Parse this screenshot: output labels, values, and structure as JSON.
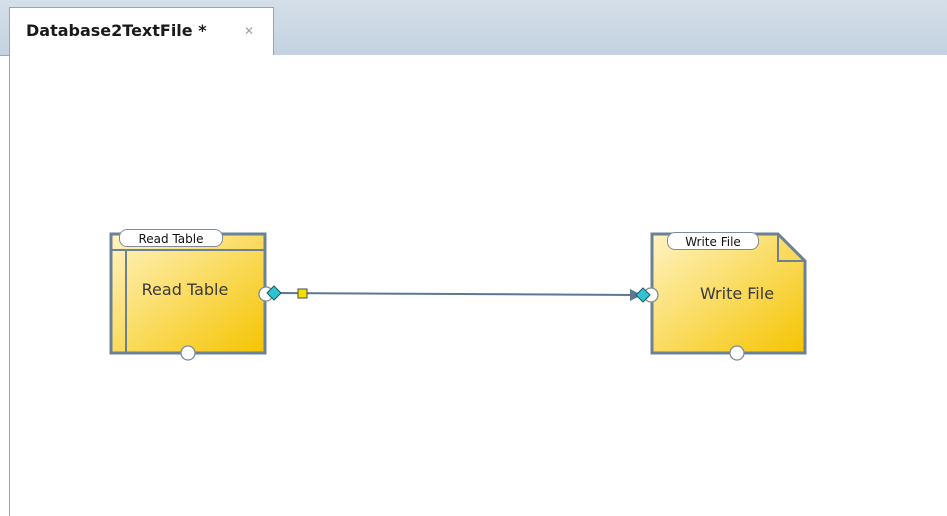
{
  "editor_tab": {
    "title": "Database2TextFile",
    "dirty_marker": "*",
    "close_icon": "close-icon"
  },
  "diagram": {
    "nodes": [
      {
        "id": "read",
        "name": "Read Table",
        "header": "Read Table",
        "shape": "table-node"
      },
      {
        "id": "write",
        "name": "Write File",
        "header": "Write File",
        "shape": "document-node"
      }
    ],
    "connections": [
      {
        "from": "read",
        "to": "write"
      }
    ],
    "colors": {
      "node_fill_light": "#fff3c2",
      "node_fill_dark": "#f5c400",
      "node_border": "#6d8194",
      "connector": "#5d7790",
      "port": "#ffffff",
      "port_diamond": "#2ec4d0",
      "bend_handle": "#f2e000"
    }
  }
}
